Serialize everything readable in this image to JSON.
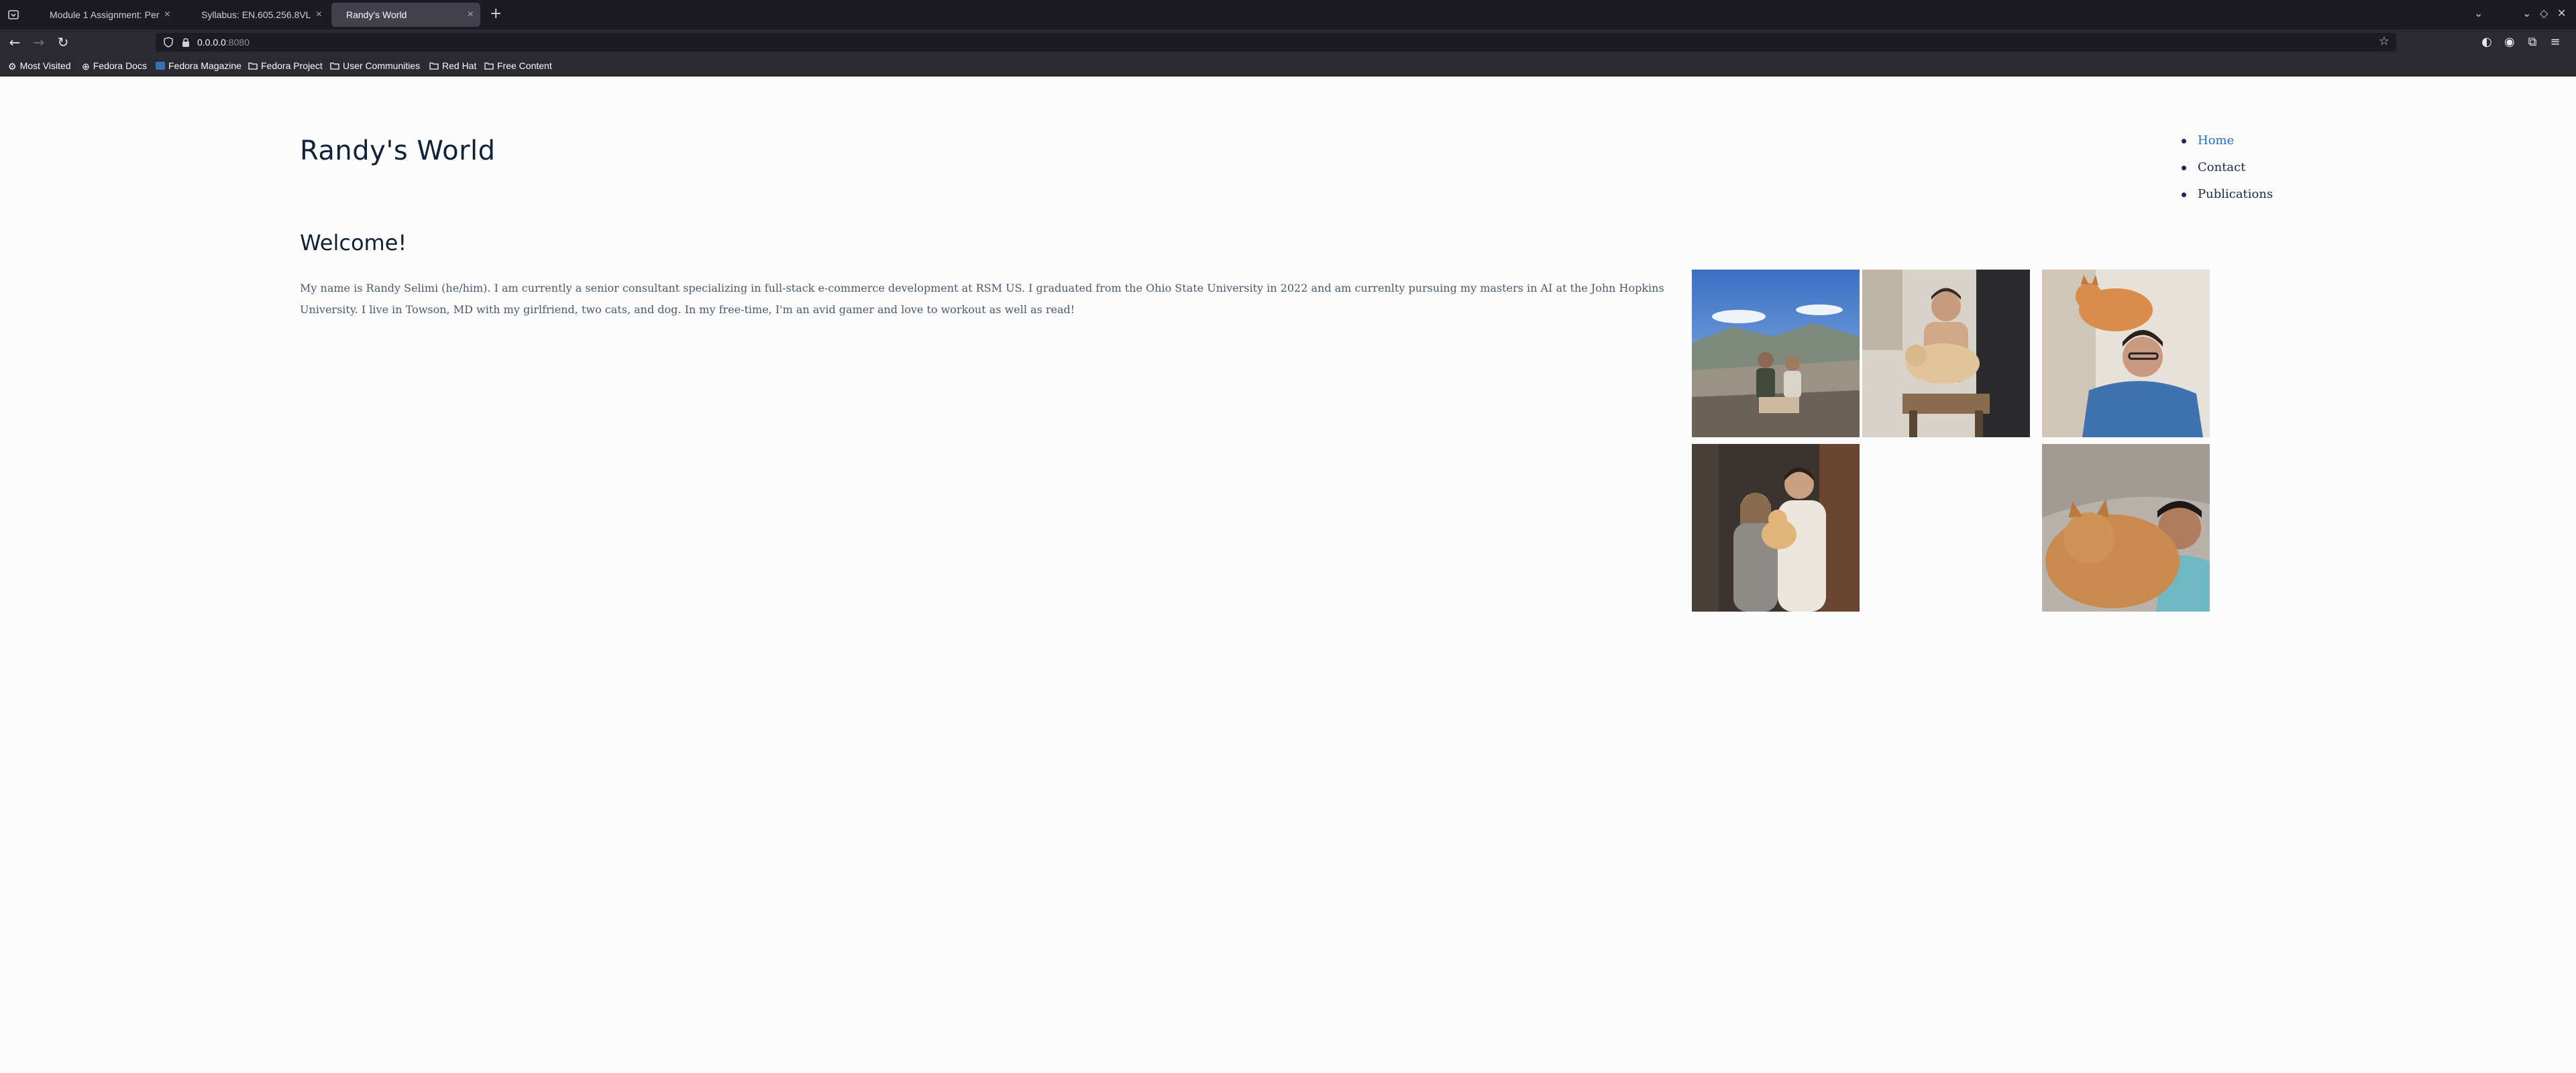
{
  "browser": {
    "tabs": [
      {
        "label": "Module 1 Assignment: Per",
        "active": false
      },
      {
        "label": "Syllabus: EN.605.256.8VL",
        "active": false
      },
      {
        "label": "Randy's World",
        "active": true
      }
    ],
    "url": {
      "host": "0.0.0.0",
      "port": ":8080"
    },
    "bookmarks": [
      "Most Visited",
      "Fedora Docs",
      "Fedora Magazine",
      "Fedora Project",
      "User Communities",
      "Red Hat",
      "Free Content"
    ]
  },
  "site": {
    "title": "Randy's World",
    "nav": [
      {
        "label": "Home",
        "active": true
      },
      {
        "label": "Contact",
        "active": false
      },
      {
        "label": "Publications",
        "active": false
      }
    ],
    "welcome": "Welcome!",
    "intro": "My name is Randy Selimi (he/him). I am currently a senior consultant specializing in full-stack e-commerce development at RSM US. I graduated from the Ohio State University in 2022 and am currenlty pursuing my masters in AI at the John Hopkins University. I live in Towson, MD with my girlfriend, two cats, and dog. In my free-time, I'm an avid gamer and love to workout as well as read!"
  },
  "colors": {
    "accent": "#1e73c7",
    "heading": "#0f2238",
    "text": "#4a5a6e"
  }
}
